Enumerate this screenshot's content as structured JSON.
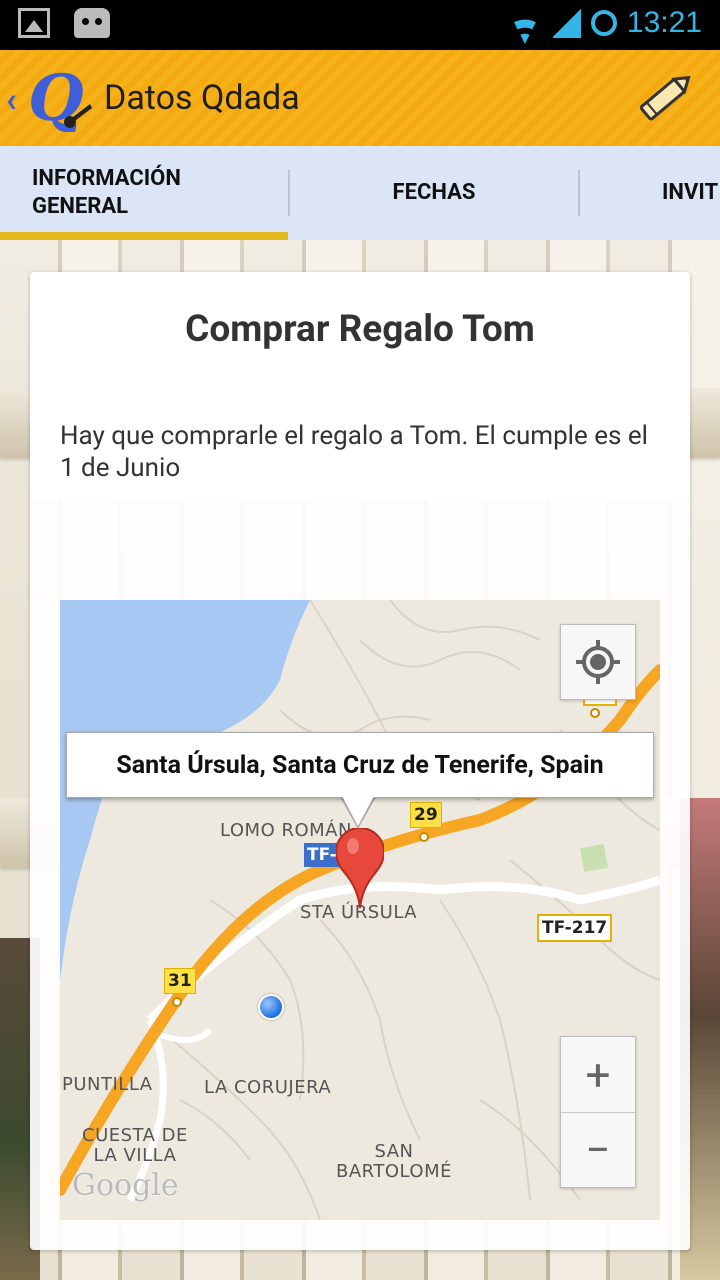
{
  "status_bar": {
    "time": "13:21",
    "left_icons": [
      "image-icon",
      "android-icon"
    ],
    "right_icons": [
      "wifi-icon",
      "signal-icon",
      "sync-icon"
    ],
    "accent_color": "#33b5e5"
  },
  "action_bar": {
    "title": "Datos Qdada",
    "back_glyph": "‹",
    "logo_letter": "Q",
    "edit_icon": "pencil-icon",
    "background_color": "#f6b21b"
  },
  "tabs": [
    {
      "label_line1": "INFORMACIÓN",
      "label_line2": "GENERAL",
      "selected": true
    },
    {
      "label": "FECHAS",
      "selected": false
    },
    {
      "label": "INVIT",
      "selected": false
    }
  ],
  "card": {
    "title": "Comprar Regalo Tom",
    "description": "Hay que comprarle el regalo a Tom. El cumple es el 1 de Junio"
  },
  "map": {
    "info_window": "Santa Úrsula, Santa Cruz de Tenerife, Spain",
    "labels": {
      "lomo_roman": "LOMO ROMÁN",
      "sta_ursula": "STA ÚRSULA",
      "puntilla": "PUNTILLA",
      "la_corujera": "LA CORUJERA",
      "cuesta_line1": "CUESTA DE",
      "cuesta_line2": "LA VILLA",
      "san_line1": "SAN",
      "san_line2": "BARTOLOMÉ"
    },
    "road_badges": {
      "r28": "28",
      "r29": "29",
      "r31": "31",
      "tf217": "TF-217",
      "tf_main": "TF-"
    },
    "zoom_in": "+",
    "zoom_out": "−",
    "attribution": "Google",
    "controls": [
      "locate-icon",
      "zoom-in-button",
      "zoom-out-button"
    ]
  }
}
